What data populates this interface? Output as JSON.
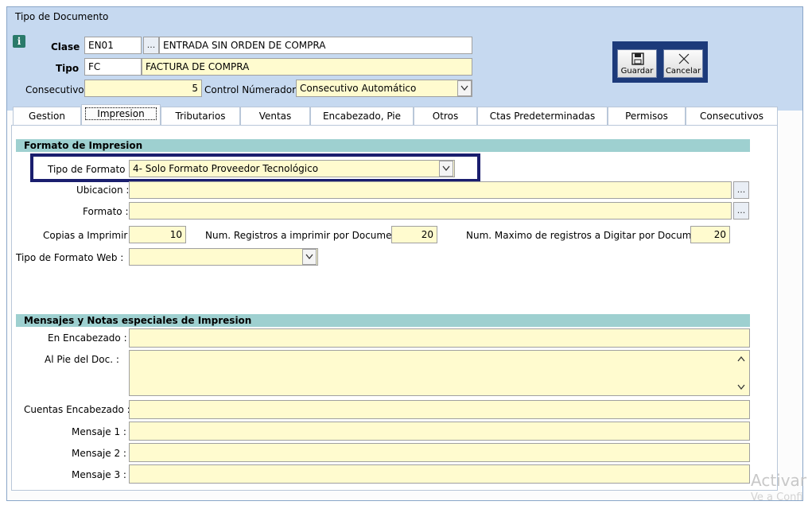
{
  "window": {
    "title": "Tipo de Documento"
  },
  "header": {
    "clase_label": "Clase",
    "clase_code": "EN01",
    "clase_desc": "ENTRADA SIN ORDEN DE COMPRA",
    "tipo_label": "Tipo",
    "tipo_code": "FC",
    "tipo_desc": "FACTURA DE COMPRA",
    "consecutivo_label": "Consecutivo",
    "consecutivo_value": "5",
    "control_label": "Control Númerador :",
    "control_value": "Consecutivo Automático",
    "lookup_glyph": "..."
  },
  "toolbar": {
    "save_label": "Guardar",
    "cancel_label": "Cancelar"
  },
  "tabs": [
    {
      "label": "Gestion"
    },
    {
      "label": "Impresion"
    },
    {
      "label": "Tributarios"
    },
    {
      "label": "Ventas"
    },
    {
      "label": "Encabezado, Pie"
    },
    {
      "label": "Otros"
    },
    {
      "label": "Ctas Predeterminadas"
    },
    {
      "label": "Permisos"
    },
    {
      "label": "Consecutivos"
    }
  ],
  "formato": {
    "section_title": "Formato de Impresion",
    "tipo_formato_label": "Tipo de Formato :",
    "tipo_formato_value": "4- Solo Formato Proveedor Tecnológico",
    "ubicacion_label": "Ubicacion :",
    "ubicacion_value": "",
    "formato_label": "Formato :",
    "formato_value": "",
    "copias_label": "Copias a Imprimir :",
    "copias_value": "10",
    "num_reg_label": "Num. Registros a imprimir  por Documento",
    "num_reg_value": "20",
    "num_max_label": "Num. Maximo de registros a Digitar por Documento",
    "num_max_value": "20",
    "tipo_web_label": "Tipo de Formato Web :",
    "tipo_web_value": ""
  },
  "mensajes": {
    "section_title": "Mensajes  y  Notas especiales de Impresion",
    "encabezado_label": "En Encabezado :",
    "pie_label": "Al Pie del Doc. :",
    "cuentas_label": "Cuentas Encabezado :",
    "mensaje1_label": "Mensaje 1 :",
    "mensaje2_label": "Mensaje 2 :",
    "mensaje3_label": "Mensaje 3 :"
  },
  "watermark": {
    "line1": "Activar",
    "line2": "Ve a Confi"
  },
  "colors": {
    "field_bg": "#fffbcf",
    "section_bg": "#9ed0d0",
    "header_bg": "#c6d9f0",
    "highlight": "#1a1e6e"
  }
}
